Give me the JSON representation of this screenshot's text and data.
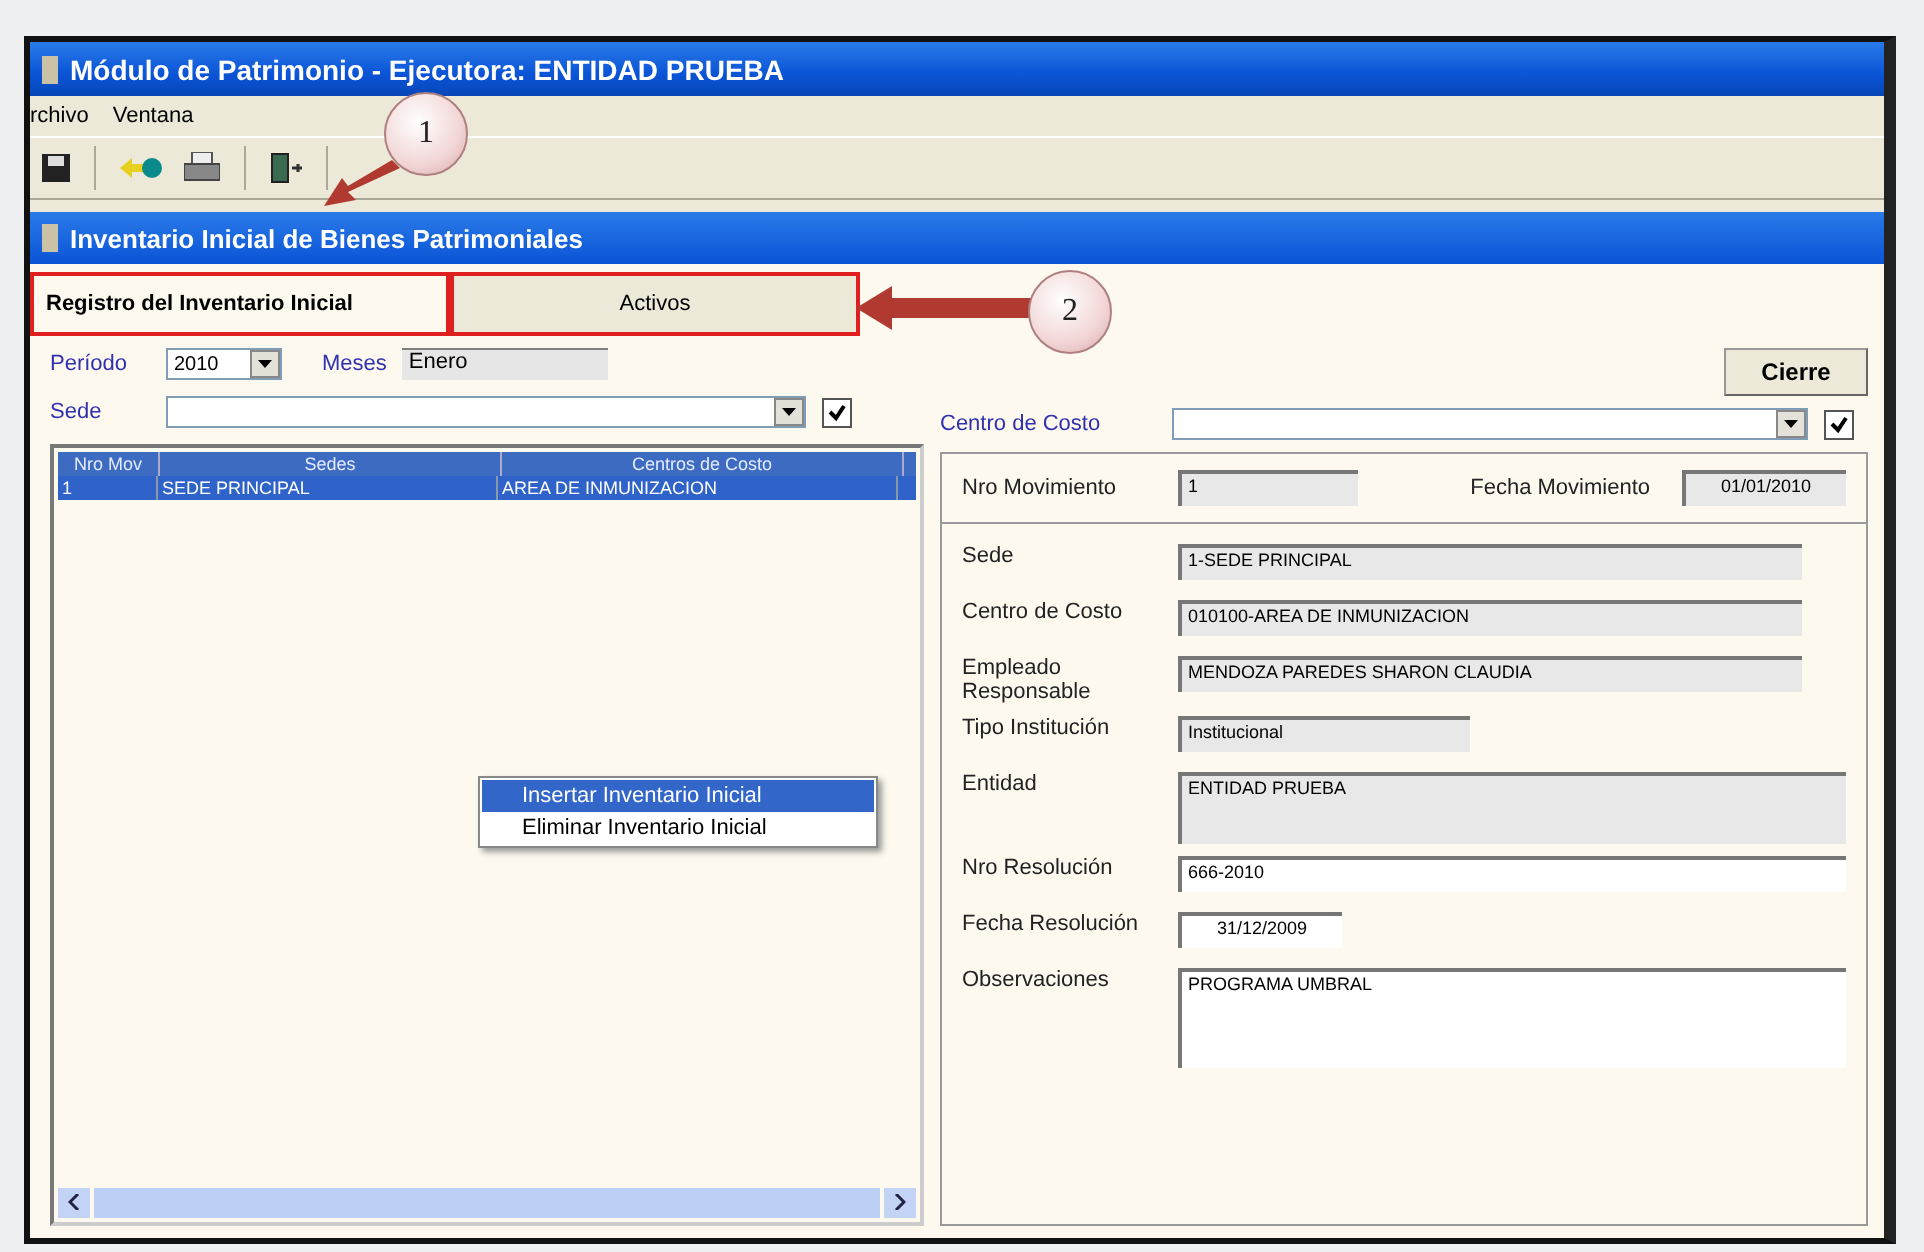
{
  "window": {
    "title": "Módulo de Patrimonio - Ejecutora: ENTIDAD PRUEBA"
  },
  "menu": [
    "rchivo",
    "Ventana"
  ],
  "subwindow": {
    "title": "Inventario Inicial de Bienes Patrimoniales"
  },
  "tabs": [
    {
      "label": "Registro del Inventario Inicial",
      "selected": true
    },
    {
      "label": "Activos",
      "selected": false
    }
  ],
  "callouts": [
    "1",
    "2"
  ],
  "filters": {
    "periodo": {
      "label": "Período",
      "value": "2010"
    },
    "meses": {
      "label": "Meses",
      "value": "Enero"
    },
    "sede": {
      "label": "Sede",
      "checked": true
    },
    "centro": {
      "label": "Centro de Costo",
      "checked": true
    }
  },
  "close_button": "Cierre",
  "table": {
    "columns": [
      "Nro Mov",
      "Sedes",
      "Centros de Costo"
    ],
    "rows": [
      {
        "cells": [
          "1",
          "SEDE PRINCIPAL",
          "AREA DE INMUNIZACION"
        ],
        "selected": true
      }
    ]
  },
  "context_menu": [
    {
      "label": "Insertar Inventario Inicial",
      "selected": true
    },
    {
      "label": "Eliminar Inventario Inicial",
      "selected": false
    }
  ],
  "header_fields": [
    {
      "label": "Nro Movimiento",
      "value": "1"
    },
    {
      "label": "Fecha Movimiento",
      "value": "01/01/2010"
    }
  ],
  "detail_fields": [
    {
      "label": "Sede",
      "value": "1-SEDE PRINCIPAL",
      "kind": "readonly"
    },
    {
      "label": "Centro de Costo",
      "value": "010100-AREA DE INMUNIZACION",
      "kind": "readonly"
    },
    {
      "label": "Empleado Responsable",
      "value": "MENDOZA PAREDES SHARON CLAUDIA",
      "kind": "readonly"
    },
    {
      "label": "Tipo Institución",
      "value": "Institucional",
      "kind": "short"
    },
    {
      "label": "Entidad",
      "value": "ENTIDAD PRUEBA",
      "kind": "readonly_area"
    },
    {
      "label": "Nro Resolución",
      "value": "666-2010",
      "kind": "input"
    },
    {
      "label": "Fecha Resolución",
      "value": "31/12/2009",
      "kind": "date"
    },
    {
      "label": "Observaciones",
      "value": "PROGRAMA UMBRAL",
      "kind": "area"
    }
  ]
}
